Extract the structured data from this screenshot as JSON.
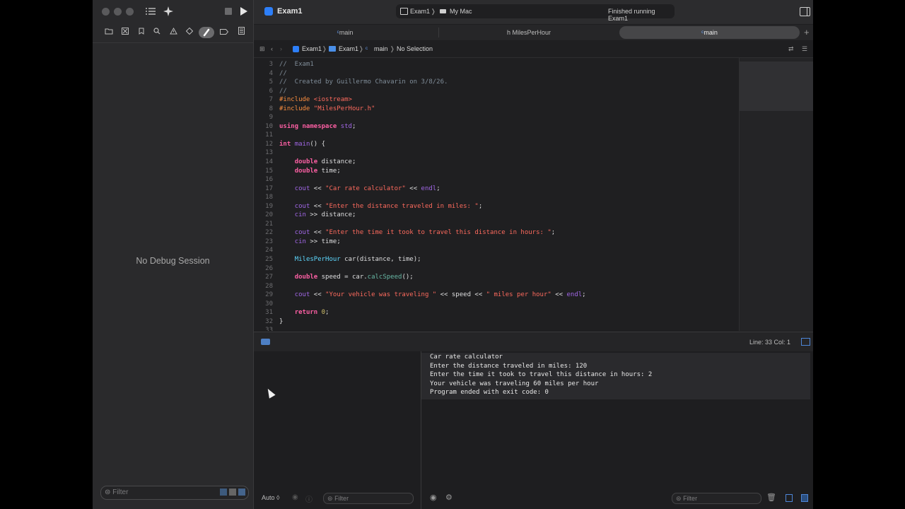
{
  "window": {
    "app_title": "Exam1"
  },
  "status": {
    "scheme": "Exam1",
    "destination": "My Mac",
    "message": "Finished running Exam1"
  },
  "tabs": [
    {
      "label": "main",
      "kind": "C++"
    },
    {
      "label": "MilesPerHour",
      "kind": "h"
    },
    {
      "label": "main",
      "kind": "C++"
    }
  ],
  "breadcrumb": [
    "Exam1",
    "Exam1",
    "main",
    "No Selection"
  ],
  "editor": {
    "lines": [
      {
        "n": "3",
        "text": "//  Exam1"
      },
      {
        "n": "4",
        "text": "//"
      },
      {
        "n": "5",
        "text": "//  Created by Guillermo Chavarin on 3/8/26."
      },
      {
        "n": "6",
        "text": "//"
      },
      {
        "n": "7",
        "text": "#include <iostream>"
      },
      {
        "n": "8",
        "text": "#include \"MilesPerHour.h\""
      },
      {
        "n": "9",
        "text": ""
      },
      {
        "n": "10",
        "text": "using namespace std;"
      },
      {
        "n": "11",
        "text": ""
      },
      {
        "n": "12",
        "text": "int main() {"
      },
      {
        "n": "13",
        "text": ""
      },
      {
        "n": "14",
        "text": "    double distance;"
      },
      {
        "n": "15",
        "text": "    double time;"
      },
      {
        "n": "16",
        "text": ""
      },
      {
        "n": "17",
        "text": "    cout << \"Car rate calculator\" << endl;"
      },
      {
        "n": "18",
        "text": ""
      },
      {
        "n": "19",
        "text": "    cout << \"Enter the distance traveled in miles: \";"
      },
      {
        "n": "20",
        "text": "    cin >> distance;"
      },
      {
        "n": "21",
        "text": ""
      },
      {
        "n": "22",
        "text": "    cout << \"Enter the time it took to travel this distance in hours: \";"
      },
      {
        "n": "23",
        "text": "    cin >> time;"
      },
      {
        "n": "24",
        "text": ""
      },
      {
        "n": "25",
        "text": "    MilesPerHour car(distance, time);"
      },
      {
        "n": "26",
        "text": ""
      },
      {
        "n": "27",
        "text": "    double speed = car.calcSpeed();"
      },
      {
        "n": "28",
        "text": ""
      },
      {
        "n": "29",
        "text": "    cout << \"Your vehicle was traveling \" << speed << \" miles per hour\" << endl;"
      },
      {
        "n": "30",
        "text": ""
      },
      {
        "n": "31",
        "text": "    return 0;"
      },
      {
        "n": "32",
        "text": "}"
      },
      {
        "n": "33",
        "text": ""
      }
    ]
  },
  "debug": {
    "no_session": "No Debug Session",
    "position": "Line: 33  Col: 1",
    "auto_label": "Auto ◊"
  },
  "console": {
    "lines": [
      "Car rate calculator",
      "Enter the distance traveled in miles: 120",
      "Enter the time it took to travel this distance in hours: 2",
      "Your vehicle was traveling 60 miles per hour",
      "Program ended with exit code: 0"
    ]
  },
  "filters": {
    "navigator": "Filter",
    "variables": "Filter",
    "console": "Filter"
  }
}
